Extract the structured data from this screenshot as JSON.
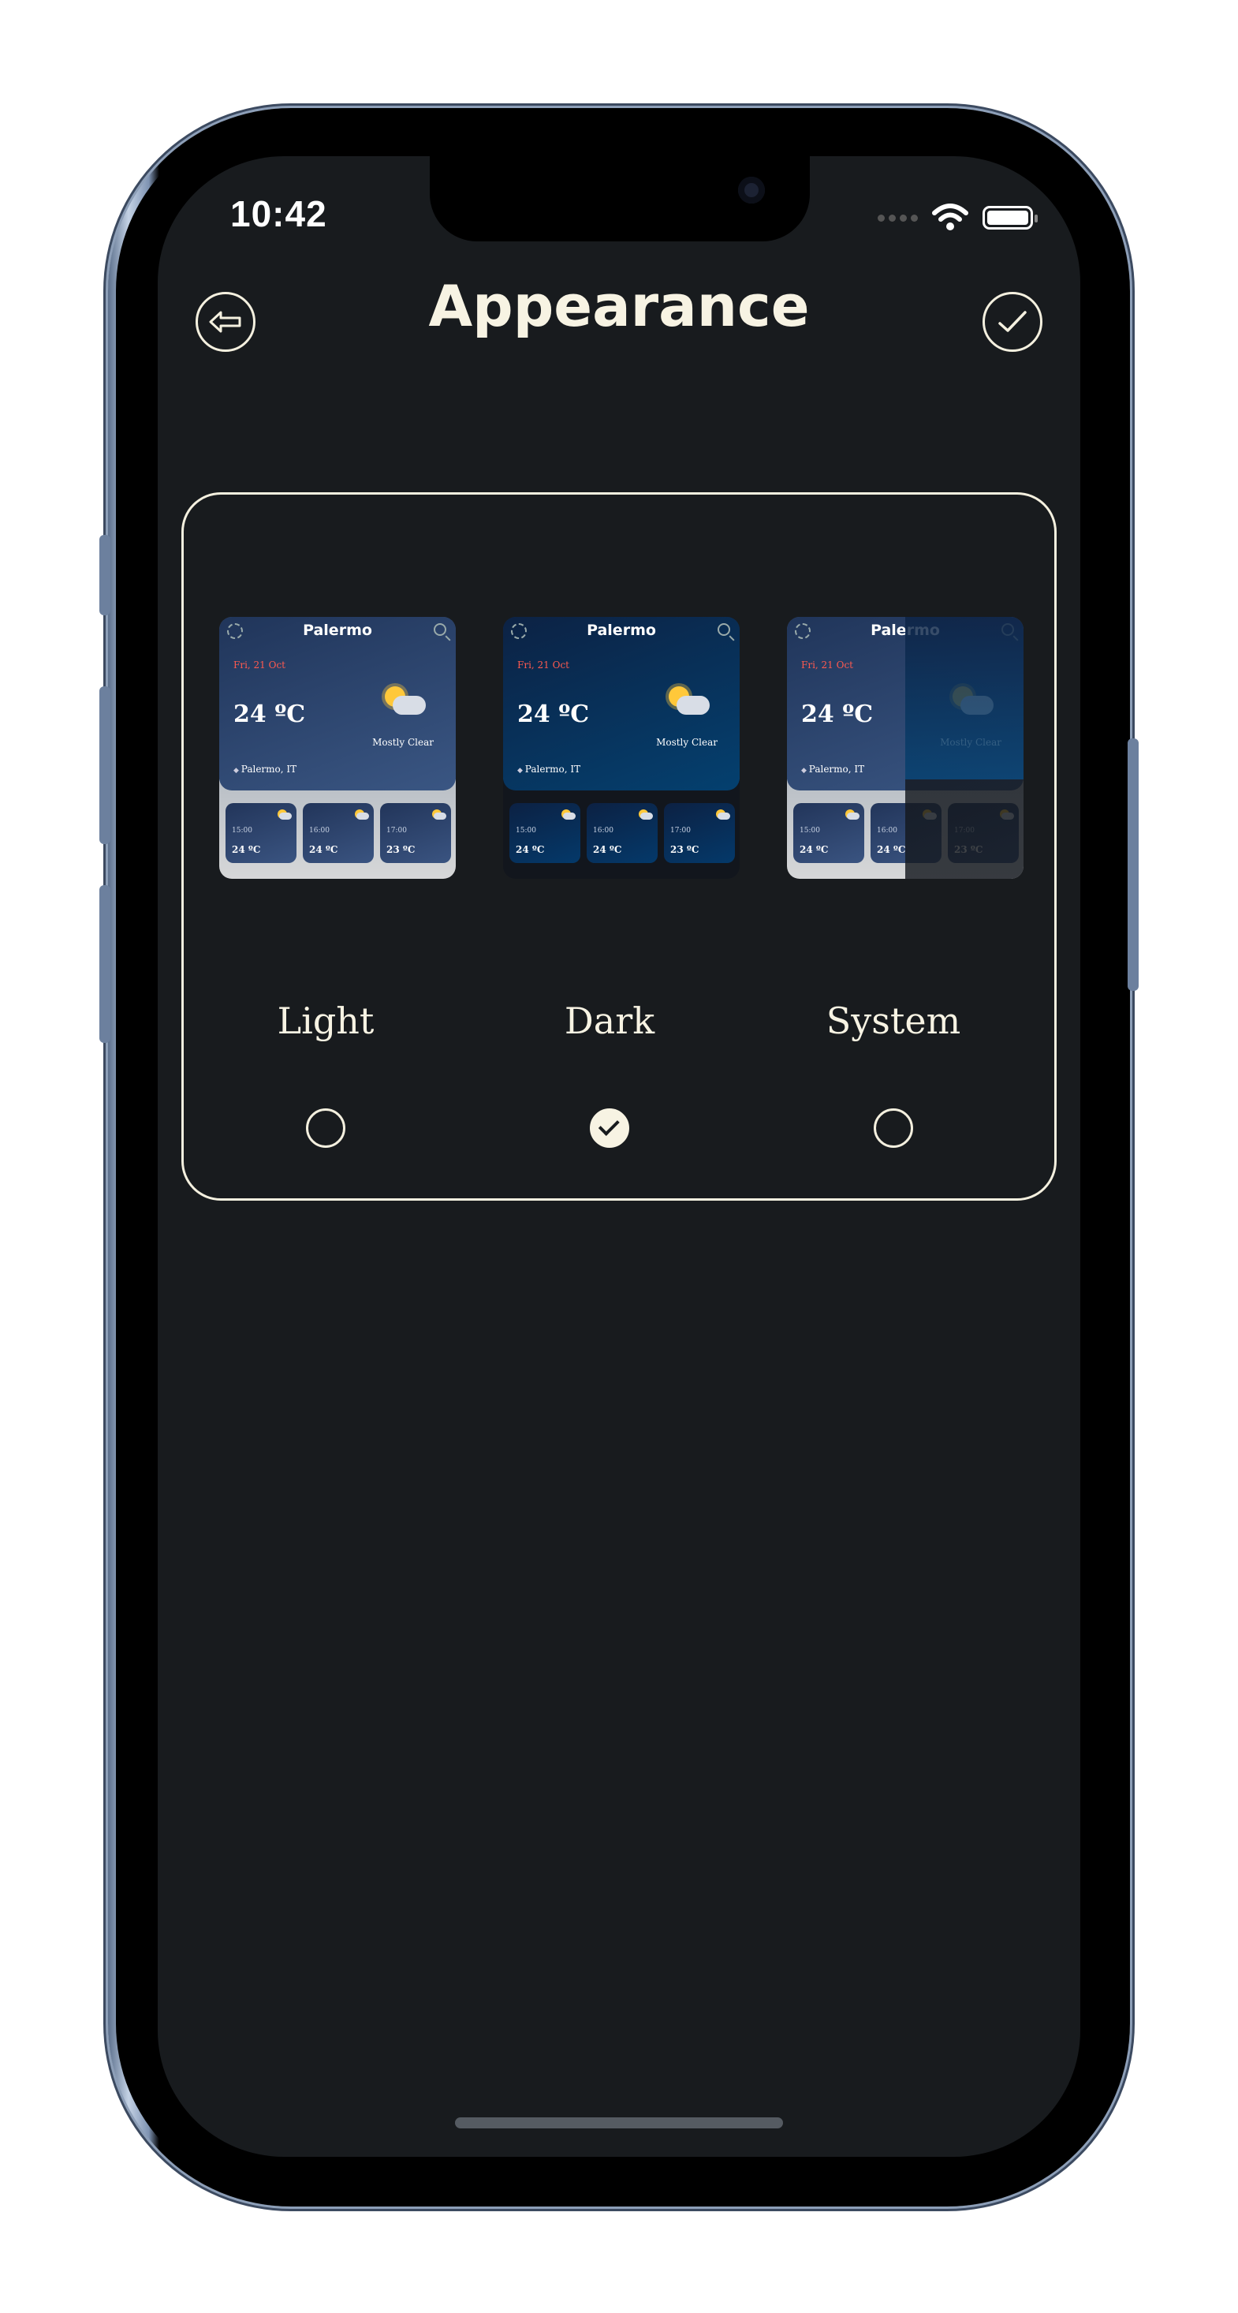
{
  "status_bar": {
    "time": "10:42"
  },
  "header": {
    "title": "Appearance",
    "back_icon": "back-arrow-icon",
    "confirm_icon": "checkmark-icon"
  },
  "preview": {
    "city": "Palermo",
    "date": "Fri, 21 Oct",
    "temperature": "24 ºC",
    "condition": "Mostly Clear",
    "location": "Palermo, IT",
    "hours": [
      {
        "time": "15:00",
        "temp": "24 ºC"
      },
      {
        "time": "16:00",
        "temp": "24 ºC"
      },
      {
        "time": "17:00",
        "temp": "23 ºC"
      }
    ]
  },
  "options": [
    {
      "label": "Light",
      "selected": false
    },
    {
      "label": "Dark",
      "selected": true
    },
    {
      "label": "System",
      "selected": false
    }
  ],
  "colors": {
    "background": "#181b1e",
    "accent": "#f7f3e3",
    "date_red": "#ff5a4f"
  }
}
